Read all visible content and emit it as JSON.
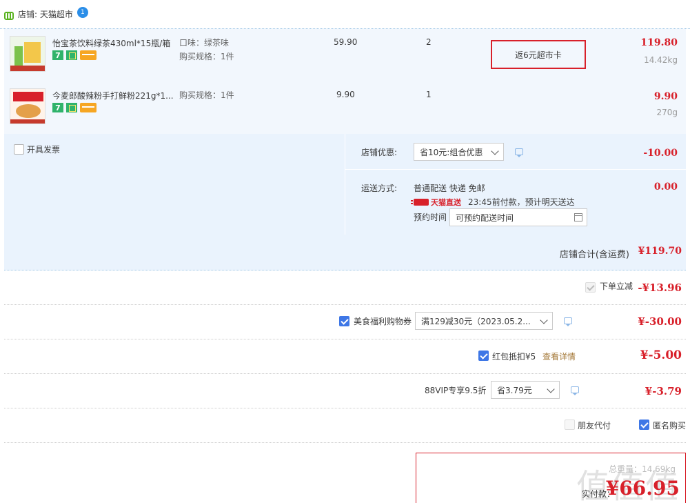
{
  "store": {
    "label": "店铺: 天猫超市",
    "ww": "1"
  },
  "items": [
    {
      "title": "怡宝茶饮料绿茶430ml*15瓶/箱",
      "flavor": "口味：绿茶味",
      "spec": "购买规格：1件",
      "price": "59.90",
      "qty": "2",
      "rebate": "返6元超市卡",
      "sum": "119.80",
      "weight": "14.42kg"
    },
    {
      "title": "今麦郎酸辣粉手打鲜粉221g*1...",
      "spec": "购买规格：1件",
      "price": "9.90",
      "qty": "1",
      "sum": "9.90",
      "weight": "270g"
    }
  ],
  "promo": {
    "invoice_label": "开具发票",
    "store_discount_label": "店铺优惠:",
    "store_discount_value": "省10元:组合优惠",
    "store_discount_amount": "-10.00",
    "shipping_label": "运送方式:",
    "shipping_value": "普通配送 快递 免邮",
    "tmall_direct": "天猫直送",
    "shipping_eta": "23:45前付款，预计明天送达",
    "reserve_label": "预约时间",
    "reserve_placeholder": "可预约配送时间",
    "shipping_amount": "0.00"
  },
  "store_total": {
    "label": "店铺合计(含运费)",
    "amount": "¥119.70"
  },
  "discounts": {
    "instant_label": "下单立减",
    "instant_amount": "-¥13.96",
    "coupon_label": "美食福利购物券",
    "coupon_value": "满129减30元（2023.05.2...",
    "coupon_amount": "¥-30.00",
    "redpacket_label": "红包抵扣¥5",
    "redpacket_link": "查看详情",
    "redpacket_amount": "¥-5.00",
    "vip_label": "88VIP专享9.5折",
    "vip_value": "省3.79元",
    "vip_amount": "¥-3.79"
  },
  "options": {
    "friend_pay": "朋友代付",
    "anonymous": "匿名购买"
  },
  "pay": {
    "weight": "总重量：14.69kg",
    "label": "实付款：",
    "amount": "¥66.95",
    "watermark": "值值值"
  }
}
